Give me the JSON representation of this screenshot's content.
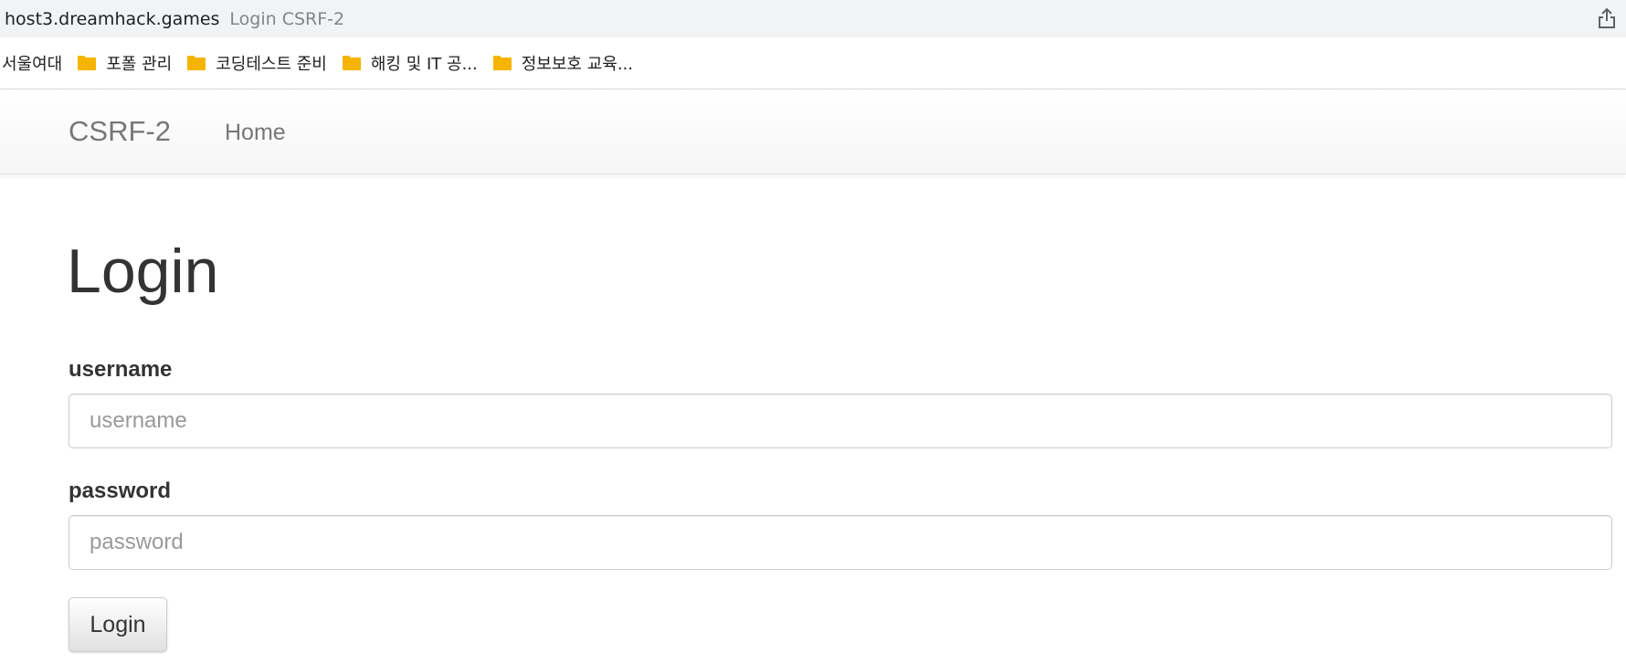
{
  "browser": {
    "url": "host3.dreamhack.games",
    "tab_title": "Login CSRF-2",
    "share_icon": "share-icon"
  },
  "bookmarks": [
    {
      "label": "서울여대",
      "icon": null
    },
    {
      "label": "포폴 관리",
      "icon": "folder-icon"
    },
    {
      "label": "코딩테스트 준비",
      "icon": "folder-icon"
    },
    {
      "label": "해킹 및 IT 공...",
      "icon": "folder-icon"
    },
    {
      "label": "정보보호 교육...",
      "icon": "folder-icon"
    }
  ],
  "navbar": {
    "brand": "CSRF-2",
    "home_link": "Home"
  },
  "main": {
    "heading": "Login",
    "username_label": "username",
    "username_placeholder": "username",
    "username_value": "",
    "password_label": "password",
    "password_placeholder": "password",
    "password_value": "",
    "login_button": "Login"
  },
  "colors": {
    "folder": "#f5b400",
    "navbar_text": "#777777",
    "heading_text": "#333333"
  }
}
